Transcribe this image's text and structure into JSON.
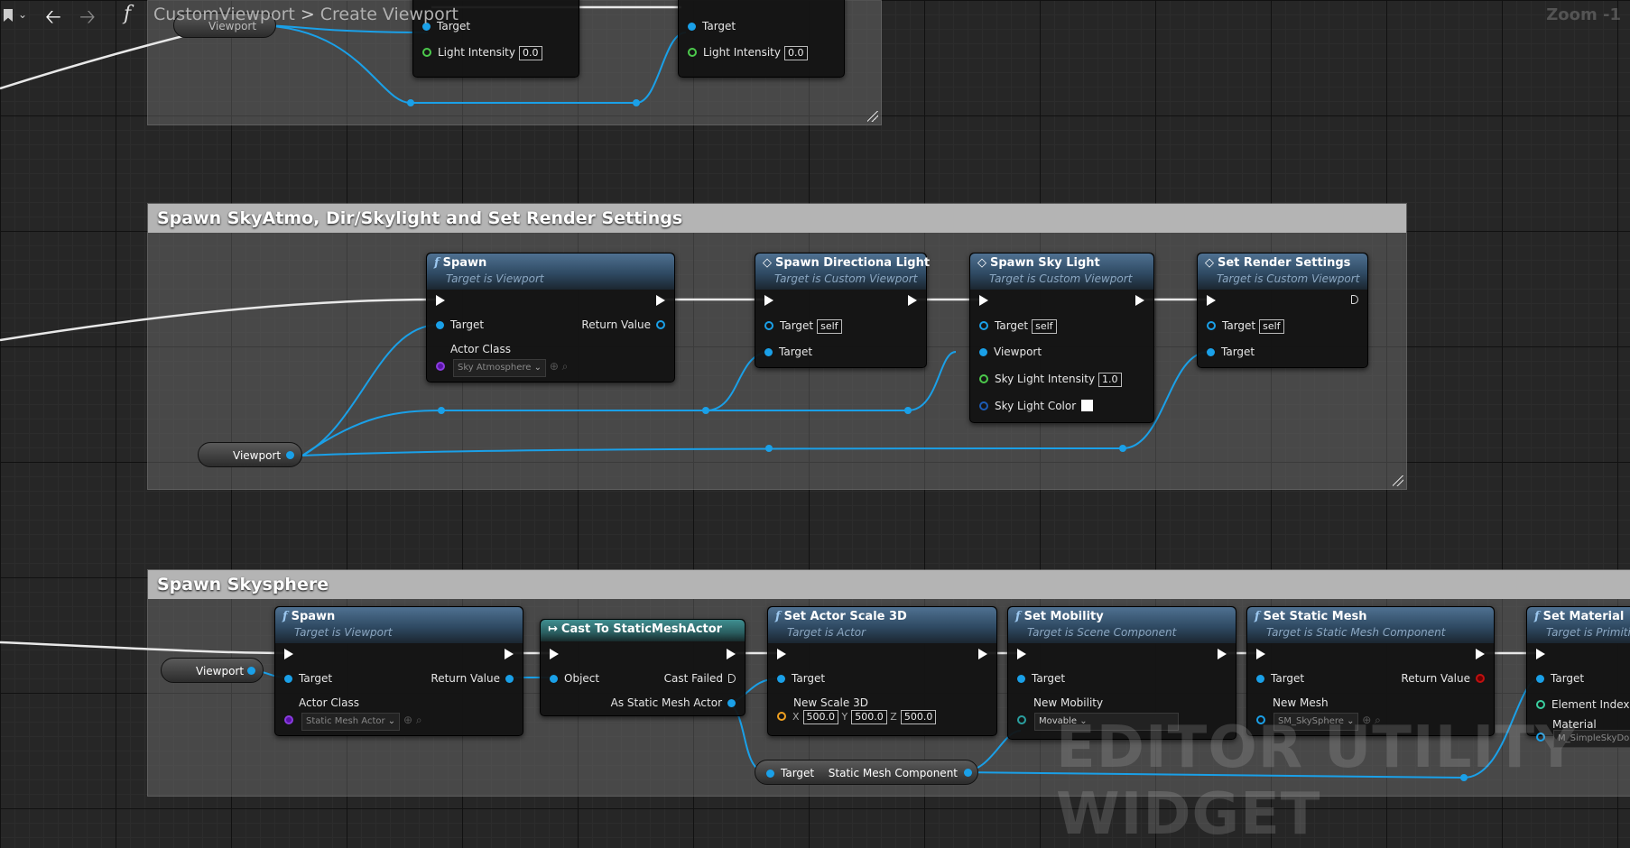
{
  "toolbar": {
    "back_icon": "arrow-left-icon",
    "forward_icon": "arrow-right-icon",
    "function_symbol": "f"
  },
  "breadcrumb": {
    "root": "CustomViewport",
    "separator": ">",
    "current": "Create Viewport"
  },
  "zoom_label": "Zoom -1",
  "watermark": "EDITOR UTILITY WIDGET",
  "top_section": {
    "variable": "Viewport",
    "node_a": {
      "target": "Target",
      "light_intensity_label": "Light Intensity",
      "light_intensity_value": "0.0"
    },
    "node_b": {
      "target": "Target",
      "light_intensity_label": "Light Intensity",
      "light_intensity_value": "0.0"
    }
  },
  "comment_sky": {
    "title": "Spawn SkyAtmo, Dir/Skylight and Set Render Settings",
    "variable": "Viewport",
    "spawn": {
      "title": "Spawn",
      "subtitle": "Target is Viewport",
      "target": "Target",
      "return_value": "Return Value",
      "actor_class": "Actor Class",
      "actor_class_value": "Sky Atmosphere"
    },
    "dir_light": {
      "title": "Spawn Directiona Light",
      "subtitle": "Target is Custom Viewport",
      "target_self": "Target",
      "self_value": "self",
      "target": "Target"
    },
    "sky_light": {
      "title": "Spawn Sky Light",
      "subtitle": "Target is Custom Viewport",
      "target_self": "Target",
      "self_value": "self",
      "viewport": "Viewport",
      "intensity_label": "Sky Light Intensity",
      "intensity_value": "1.0",
      "color_label": "Sky Light Color"
    },
    "render": {
      "title": "Set Render Settings",
      "subtitle": "Target is Custom Viewport",
      "target_self": "Target",
      "self_value": "self",
      "target": "Target"
    }
  },
  "comment_skysphere": {
    "title": "Spawn Skysphere",
    "variable": "Viewport",
    "spawn": {
      "title": "Spawn",
      "subtitle": "Target is Viewport",
      "target": "Target",
      "return_value": "Return Value",
      "actor_class": "Actor Class",
      "actor_class_value": "Static Mesh Actor"
    },
    "cast": {
      "title": "Cast To StaticMeshActor",
      "object": "Object",
      "cast_failed": "Cast Failed",
      "as_actor": "As Static Mesh Actor"
    },
    "scale": {
      "title": "Set Actor Scale 3D",
      "subtitle": "Target is Actor",
      "target": "Target",
      "new_scale": "New Scale 3D",
      "x_label": "X",
      "x": "500.0",
      "y_label": "Y",
      "y": "500.0",
      "z_label": "Z",
      "z": "500.0"
    },
    "mobility": {
      "title": "Set Mobility",
      "subtitle": "Target is Scene Component",
      "target": "Target",
      "new_mobility": "New Mobility",
      "mobility_value": "Movable"
    },
    "static_mesh": {
      "title": "Set Static Mesh",
      "subtitle": "Target is Static Mesh Component",
      "target": "Target",
      "return_value": "Return Value",
      "new_mesh": "New Mesh",
      "mesh_value": "SM_SkySphere"
    },
    "material": {
      "title": "Set Material",
      "subtitle": "Target is Primitiv",
      "target": "Target",
      "element_index": "Element Index",
      "material": "Material",
      "material_value": "M_SimpleSkyDo"
    },
    "getter": {
      "target": "Target",
      "component": "Static Mesh Component"
    }
  }
}
